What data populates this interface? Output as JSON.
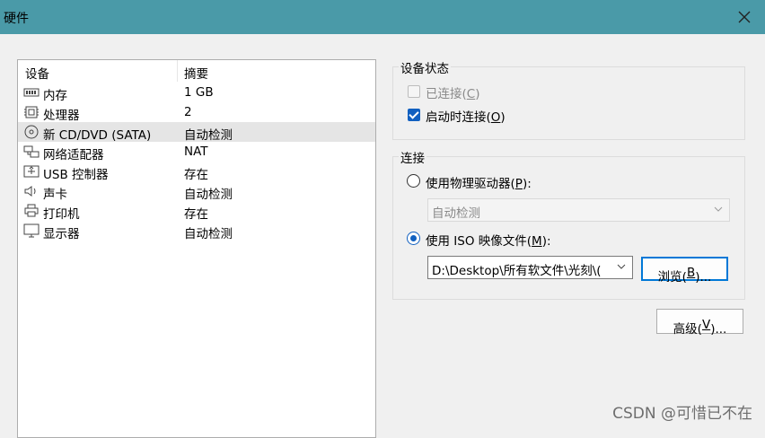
{
  "window": {
    "title": "硬件",
    "close_icon": "close-icon"
  },
  "device_list": {
    "headers": {
      "device": "设备",
      "summary": "摘要"
    },
    "rows": [
      {
        "name": "内存",
        "summary": "1 GB",
        "icon": "memory-icon",
        "selected": false
      },
      {
        "name": "处理器",
        "summary": "2",
        "icon": "processor-icon",
        "selected": false
      },
      {
        "name": "新 CD/DVD (SATA)",
        "summary": "自动检测",
        "icon": "cd-dvd-icon",
        "selected": true
      },
      {
        "name": "网络适配器",
        "summary": "NAT",
        "icon": "network-adapter-icon",
        "selected": false
      },
      {
        "name": "USB 控制器",
        "summary": "存在",
        "icon": "usb-icon",
        "selected": false
      },
      {
        "name": "声卡",
        "summary": "自动检测",
        "icon": "speaker-icon",
        "selected": false
      },
      {
        "name": "打印机",
        "summary": "存在",
        "icon": "printer-icon",
        "selected": false
      },
      {
        "name": "显示器",
        "summary": "自动检测",
        "icon": "monitor-icon",
        "selected": false
      }
    ]
  },
  "device_status": {
    "label": "设备状态",
    "connected": {
      "text": "已连接(",
      "key": "C",
      "end": ")",
      "checked": false,
      "enabled": false
    },
    "connect_at_power_on": {
      "text": "启动时连接(",
      "key": "O",
      "end": ")",
      "checked": true,
      "enabled": true
    }
  },
  "connection": {
    "label": "连接",
    "physical_drive": {
      "text": "使用物理驱动器(",
      "key": "P",
      "end": "):",
      "selected": false,
      "dropdown_value": "自动检测"
    },
    "iso_image": {
      "text": "使用 ISO 映像文件(",
      "key": "M",
      "end": "):",
      "selected": true,
      "path_value": "D:\\Desktop\\所有软文件\\光刻\\("
    },
    "browse_button": {
      "text": "浏览(",
      "key": "B",
      "end": ")..."
    }
  },
  "advanced_button": {
    "text": "高级(",
    "key": "V",
    "end": ")..."
  },
  "watermark": "CSDN @可惜已不在",
  "colors": {
    "title_bar": "#4a9aa8",
    "accent": "#1160c0",
    "selection": "#e5e5e5"
  }
}
